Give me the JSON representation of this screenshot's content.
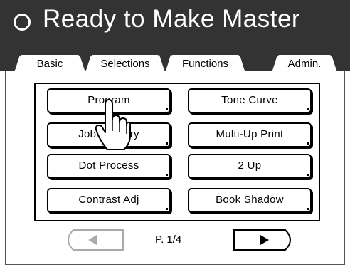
{
  "header": {
    "title": "Ready to Make Master",
    "status_icon": "circle-icon"
  },
  "tabs": [
    {
      "label": "Basic",
      "active": false
    },
    {
      "label": "Selections",
      "active": false
    },
    {
      "label": "Functions",
      "active": true
    },
    {
      "label": "Admin.",
      "active": false
    }
  ],
  "functions": {
    "buttons": [
      {
        "label": "Program"
      },
      {
        "label": "Job Memory"
      },
      {
        "label": "Dot Process"
      },
      {
        "label": "Contrast Adj"
      },
      {
        "label": "Tone Curve"
      },
      {
        "label": "Multi-Up Print"
      },
      {
        "label": "2 Up"
      },
      {
        "label": "Book Shadow"
      }
    ]
  },
  "pagination": {
    "page_text": "P. 1/4",
    "prev_icon": "left-triangle-icon",
    "prev_enabled": false,
    "next_icon": "right-triangle-icon",
    "next_enabled": true
  },
  "cursor": {
    "icon": "hand-pointer-icon"
  },
  "colors": {
    "header_bg": "#333333",
    "header_text": "#ffffff",
    "disabled": "#aaaaaa"
  }
}
